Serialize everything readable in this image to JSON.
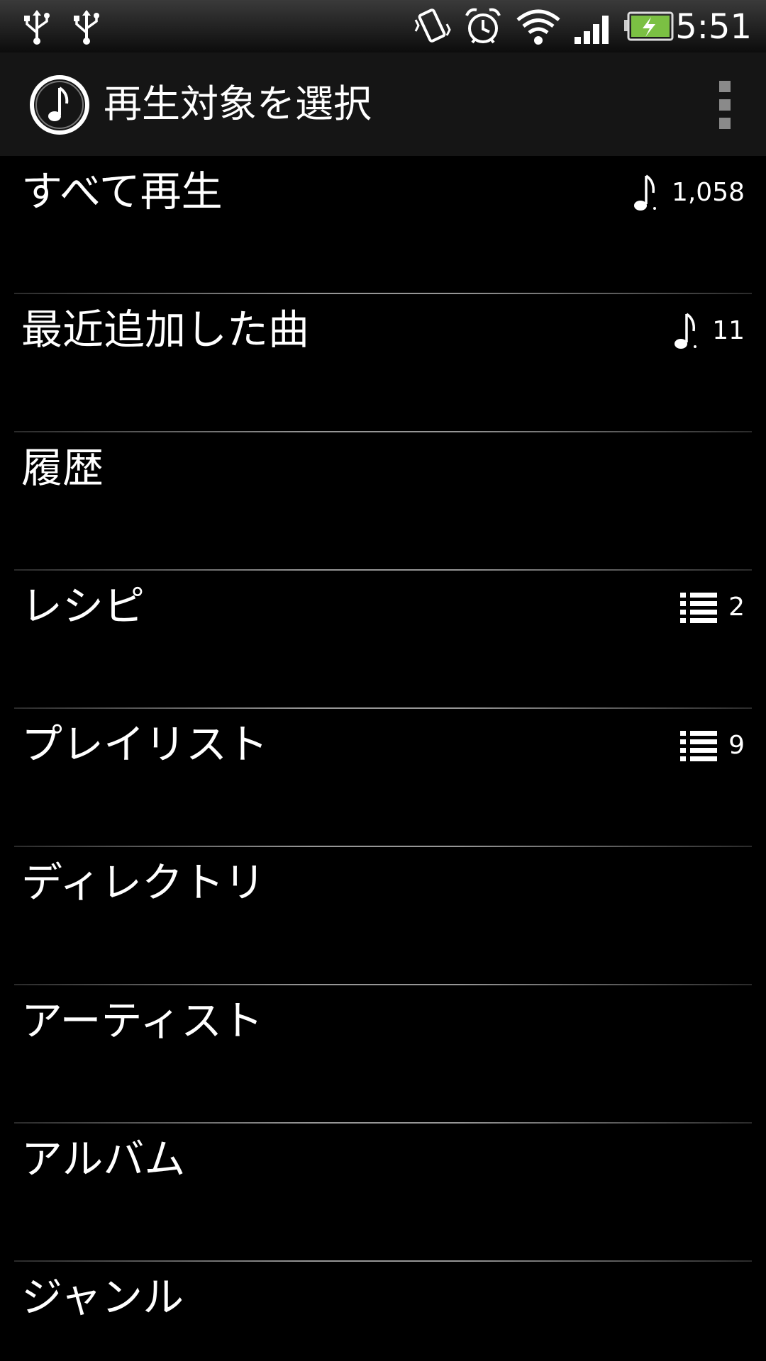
{
  "status_bar": {
    "time": "5:51",
    "icons": [
      "usb-icon",
      "usb-icon",
      "vibrate-icon",
      "alarm-icon",
      "wifi-icon",
      "signal-icon",
      "battery-charging-icon"
    ]
  },
  "action_bar": {
    "app_icon": "music-note-icon",
    "title": "再生対象を選択",
    "overflow_icon": "overflow-menu-icon"
  },
  "list": {
    "items": [
      {
        "label": "すべて再生",
        "count": "1,058",
        "icon": "music-note-icon"
      },
      {
        "label": "最近追加した曲",
        "count": "11",
        "icon": "music-note-icon"
      },
      {
        "label": "履歴"
      },
      {
        "label": "レシピ",
        "count": "2",
        "icon": "list-icon"
      },
      {
        "label": "プレイリスト",
        "count": "9",
        "icon": "list-icon"
      },
      {
        "label": "ディレクトリ"
      },
      {
        "label": "アーティスト"
      },
      {
        "label": "アルバム"
      },
      {
        "label": "ジャンル"
      }
    ]
  }
}
